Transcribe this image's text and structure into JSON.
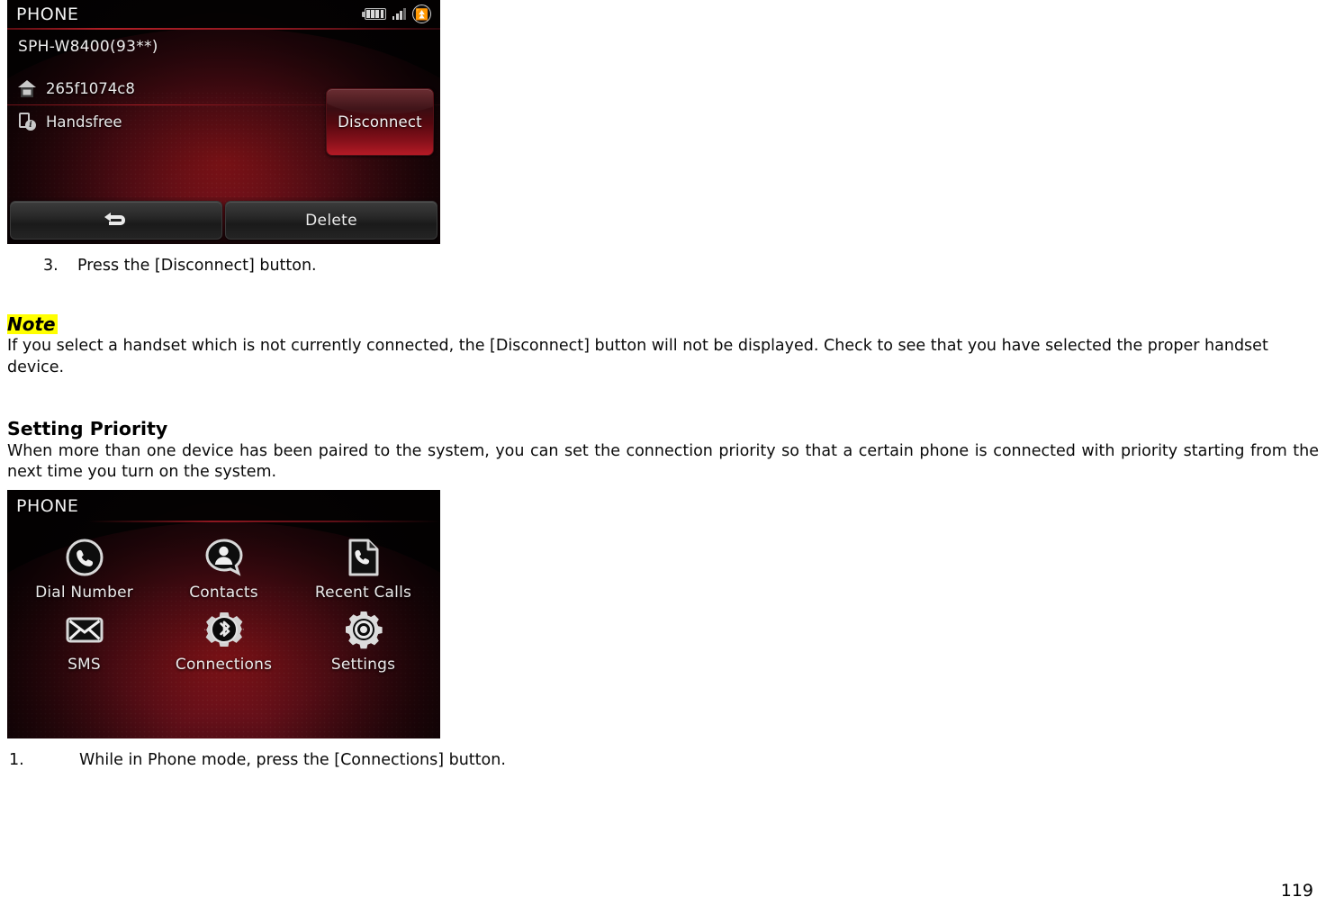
{
  "document": {
    "page_number": "119",
    "step3": {
      "number": "3.",
      "text": "Press the [Disconnect] button."
    },
    "note": {
      "heading": "Note",
      "body": "If you select a handset which is not currently connected, the [Disconnect] button will not be displayed. Check to see that you have selected the proper handset device."
    },
    "section": {
      "heading": "Setting Priority",
      "body": "When more than one device has been paired to the system, you can set the connection priority so that a certain phone is connected with priority starting from the next time you turn on the system."
    },
    "step1": {
      "number": "1.",
      "text": "While in Phone mode, press the [Connections] button."
    }
  },
  "screen_paired_device": {
    "title": "PHONE",
    "status_icons": [
      "battery-icon",
      "signal-icon",
      "bluetooth-icon"
    ],
    "device_name": "SPH-W8400(93**)",
    "rows": [
      {
        "icon": "home-icon",
        "label": "265f1074c8"
      },
      {
        "icon": "device-info-icon",
        "label": "Handsfree"
      }
    ],
    "disconnect_button": "Disconnect",
    "bottom_buttons": [
      {
        "icon": "back-arrow-icon",
        "label": ""
      },
      {
        "icon": "",
        "label": "Delete"
      }
    ]
  },
  "screen_phone_menu": {
    "title": "PHONE",
    "tiles": [
      {
        "icon": "phone-handset-icon",
        "label": "Dial Number"
      },
      {
        "icon": "contacts-person-icon",
        "label": "Contacts"
      },
      {
        "icon": "recent-calls-page-icon",
        "label": "Recent Calls"
      },
      {
        "icon": "envelope-icon",
        "label": "SMS"
      },
      {
        "icon": "bluetooth-gear-icon",
        "label": "Connections"
      },
      {
        "icon": "gear-icon",
        "label": "Settings"
      }
    ]
  },
  "colors": {
    "accent_red": "#b41a25",
    "highlight_yellow": "#ffff00",
    "screen_background": "#0a0405"
  }
}
